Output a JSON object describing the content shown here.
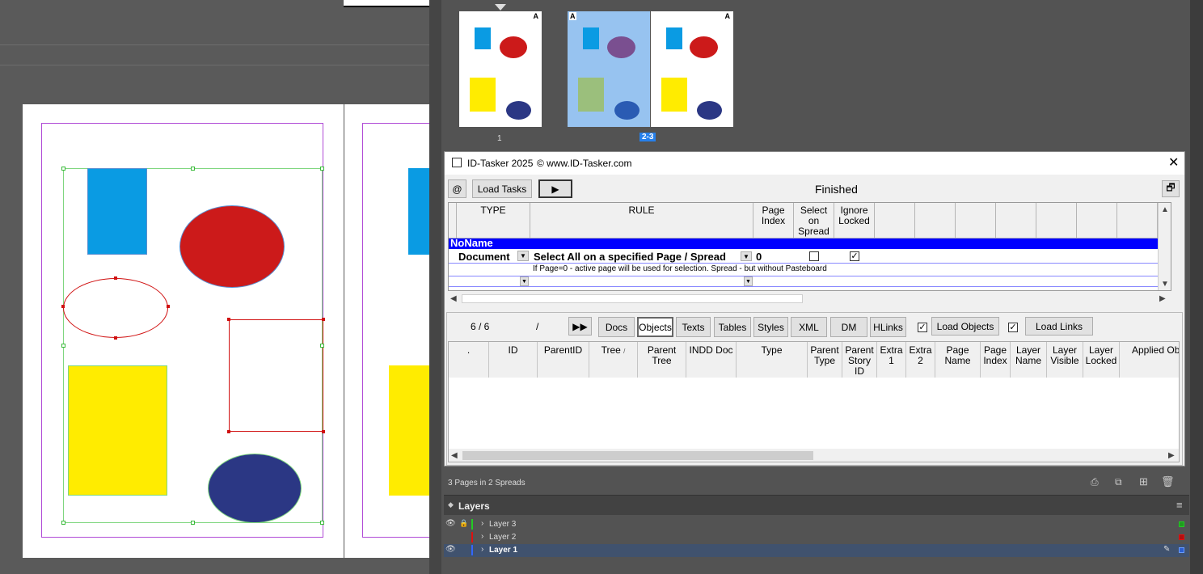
{
  "pages_panel": {
    "thumb1_label": "1",
    "thumb2_label": "2-3",
    "master_a": "A"
  },
  "dialog": {
    "title": "ID-Tasker 2025",
    "copyright": "© www.ID-Tasker.com",
    "at_label": "@",
    "load_tasks": "Load Tasks",
    "play_icon": "play-icon",
    "status": "Finished",
    "restore_icon": "restore-icon",
    "close_icon": "close-icon",
    "grid_headers": [
      "TYPE",
      "RULE",
      "Page Index",
      "Select on Spread",
      "Ignore Locked"
    ],
    "group_name": "NoName",
    "rule_row": {
      "type": "Document",
      "rule": "Select All on a specified Page / Spread",
      "page_index": "0",
      "select_on_spread": false,
      "ignore_locked": true,
      "description": "If Page=0 - active page will be used for selection. Spread - but without Pasteboard"
    },
    "counter": "6 / 6",
    "slash": "/",
    "tabs": [
      "Docs",
      "Objects",
      "Texts",
      "Tables",
      "Styles",
      "XML",
      "DM",
      "HLinks"
    ],
    "active_tab": "Objects",
    "load_objects_checked": true,
    "load_objects": "Load Objects",
    "load_links_checked": true,
    "load_links": "Load Links",
    "obj_headers": [
      ".",
      "ID",
      "ParentID",
      "Tree",
      "Parent Tree",
      "INDD Doc",
      "Type",
      "Parent Type",
      "Parent Story ID",
      "Extra 1",
      "Extra 2",
      "Page Name",
      "Page Index",
      "Layer Name",
      "Layer Visible",
      "Layer Locked",
      "Applied Obj"
    ],
    "tree_sort": "/"
  },
  "status_bar": {
    "pages_info": "3 Pages in 2 Spreads"
  },
  "layers_panel": {
    "title": "Layers",
    "layers": [
      {
        "name": "Layer 3",
        "color": "#22cc22",
        "visible": true,
        "locked": true
      },
      {
        "name": "Layer 2",
        "color": "#e01010",
        "visible": false,
        "locked": false
      },
      {
        "name": "Layer 1",
        "color": "#3366ff",
        "visible": true,
        "locked": false,
        "selected": true
      }
    ]
  },
  "colors": {
    "blue_rect": "#0a9be3",
    "red_ellipse": "#cc1a1a",
    "yellow_rect": "#ffec00",
    "navy_ellipse": "#2b3784",
    "group_bar": "#0000ff"
  }
}
